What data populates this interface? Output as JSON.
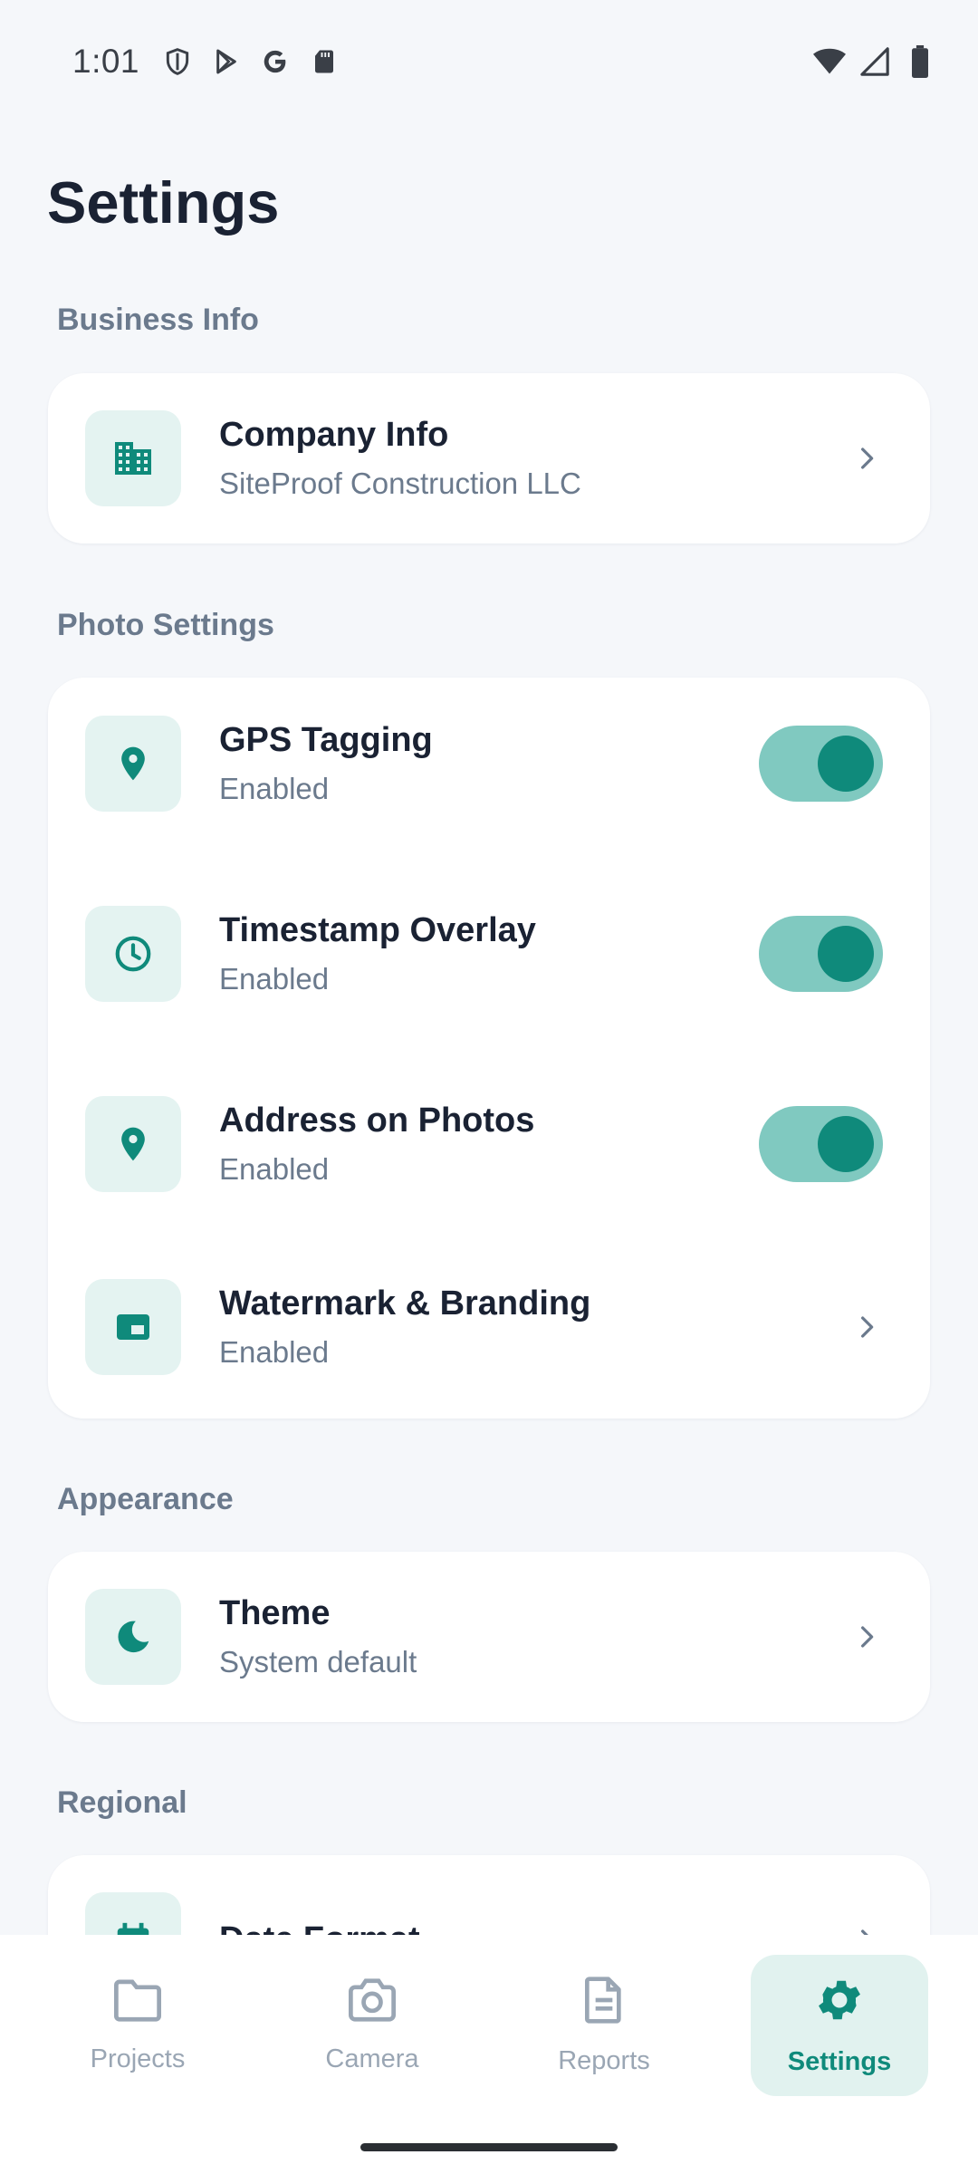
{
  "status_bar": {
    "time": "1:01",
    "icons": [
      "shield-icon",
      "play-store-icon",
      "google-icon",
      "sd-card-icon",
      "wifi-icon",
      "signal-icon",
      "battery-icon"
    ]
  },
  "page": {
    "title": "Settings"
  },
  "sections": {
    "business": {
      "label": "Business Info",
      "company": {
        "title": "Company Info",
        "subtitle": "SiteProof Construction LLC",
        "icon": "building-icon"
      }
    },
    "photo": {
      "label": "Photo Settings",
      "gps": {
        "title": "GPS Tagging",
        "subtitle": "Enabled",
        "icon": "location-pin-icon",
        "toggle_on": true
      },
      "timestamp": {
        "title": "Timestamp Overlay",
        "subtitle": "Enabled",
        "icon": "clock-icon",
        "toggle_on": true
      },
      "address": {
        "title": "Address on Photos",
        "subtitle": "Enabled",
        "icon": "location-pin-icon",
        "toggle_on": true
      },
      "watermark": {
        "title": "Watermark & Branding",
        "subtitle": "Enabled",
        "icon": "watermark-icon"
      }
    },
    "appearance": {
      "label": "Appearance",
      "theme": {
        "title": "Theme",
        "subtitle": "System default",
        "icon": "moon-icon"
      }
    },
    "regional": {
      "label": "Regional",
      "date_format": {
        "title": "Date Format",
        "icon": "calendar-icon"
      }
    }
  },
  "bottom_nav": {
    "items": [
      {
        "label": "Projects",
        "icon": "folder-icon",
        "active": false
      },
      {
        "label": "Camera",
        "icon": "camera-icon",
        "active": false
      },
      {
        "label": "Reports",
        "icon": "document-icon",
        "active": false
      },
      {
        "label": "Settings",
        "icon": "gear-icon",
        "active": true
      }
    ]
  },
  "colors": {
    "accent": "#0f8a7b",
    "accent_light": "#e4f3f1",
    "toggle_track": "#80c9c0",
    "text_primary": "#1a2233",
    "text_secondary": "#6b7a8d",
    "background": "#f5f7fa"
  }
}
